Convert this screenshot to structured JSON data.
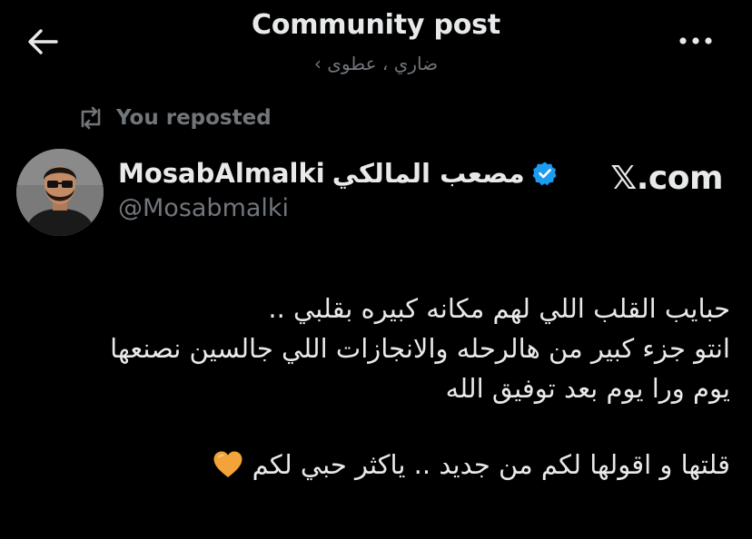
{
  "header": {
    "title": "Community post",
    "subtitle": "ضاري ، عطوى ›"
  },
  "repost": {
    "label": "You reposted"
  },
  "author": {
    "name_latin": "MosabAlmalki",
    "name_arabic": "مصعب المالكي",
    "handle": "@Mosabmalki",
    "verified": true
  },
  "watermark": "𝕏.com",
  "post": {
    "lines": [
      "حبايب القلب اللي لهم مكانه كبيره بقلبي ..",
      "انتو جزء كبير من هالرحله والانجازات اللي جالسين نصنعها",
      "يوم ورا يوم بعد توفيق الله"
    ],
    "closing": "قلتها و اقولها لكم من جديد .. ياكثر حبي لكم",
    "closing_emoji": "orange-heart-icon"
  },
  "colors": {
    "background": "#000000",
    "text": "#e7e9ea",
    "muted": "#71767b",
    "verified": "#1d9bf0",
    "heart": "#f4a23a"
  }
}
